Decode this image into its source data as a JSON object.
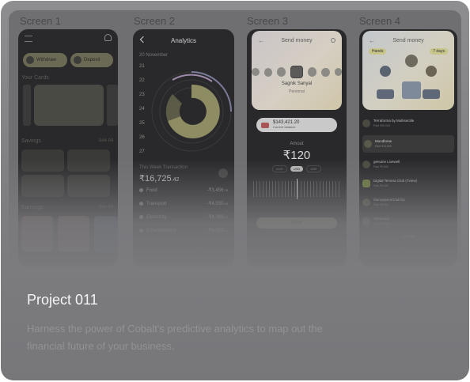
{
  "project": {
    "title": "Project 011",
    "description": "Harness the power of Cobalt's predictive analytics to map out the financial future of your business."
  },
  "screens": {
    "labels": [
      "Screen 1",
      "Screen 2",
      "Screen 3",
      "Screen 4"
    ]
  },
  "screen1": {
    "withdraw": "Withdraw",
    "deposit": "Deposit",
    "your_cards": "Your Cards",
    "savings": "Savings",
    "see_all": "See All",
    "earnings": "Earnings",
    "see_all_2": "See All"
  },
  "screen2": {
    "title": "Analytics",
    "date": "20 November",
    "days": [
      "21",
      "22",
      "23",
      "24",
      "25",
      "26",
      "27"
    ],
    "week_label": "This Week Transaction",
    "total": "₹16,725",
    "total_decimal": ".42",
    "transactions": [
      {
        "name": "Food",
        "amount": "-₹3,456",
        "decimal": ".78"
      },
      {
        "name": "Transport",
        "amount": "-₹4,550",
        "decimal": ".46"
      },
      {
        "name": "Electricity",
        "amount": "-₹4,369",
        "decimal": ".09"
      },
      {
        "name": "Entertainment",
        "amount": "-₹4,369",
        "decimal": ".09"
      }
    ]
  },
  "screen3": {
    "title": "Send money",
    "recipient_name": "Sagnik Sanyal",
    "recipient_type": "Personal",
    "balance": "$143,421.20",
    "balance_label": "Current balance",
    "amount_label": "Amout",
    "amount": "₹120",
    "currencies": [
      "EUR",
      "USD",
      "GBP"
    ],
    "send": "Send"
  },
  "screen4": {
    "title": "Send money",
    "filter_left": "Hands",
    "filter_right": "7 days",
    "list": [
      {
        "name": "Terraforma by Multisectile",
        "sub": "Paid ₹20,000"
      },
      {
        "name": "Moodbrew",
        "sub": "Paid ₹10,000"
      },
      {
        "name": "genuine Livewell",
        "sub": "Paid ₹9,500"
      },
      {
        "name": "Digital Tersera Club (Tview)",
        "sub": "Paid ₹9,000"
      },
      {
        "name": "Monospace/ClubTip",
        "sub": "Paid ₹8,000"
      },
      {
        "name": "Ultraviolet",
        "sub": "Paid ₹7,500"
      }
    ],
    "view_all": "View All"
  },
  "colors": {
    "accent_yellow": "#e8e6a6",
    "phone_bg": "#29292b",
    "card_bg": "#808083"
  }
}
